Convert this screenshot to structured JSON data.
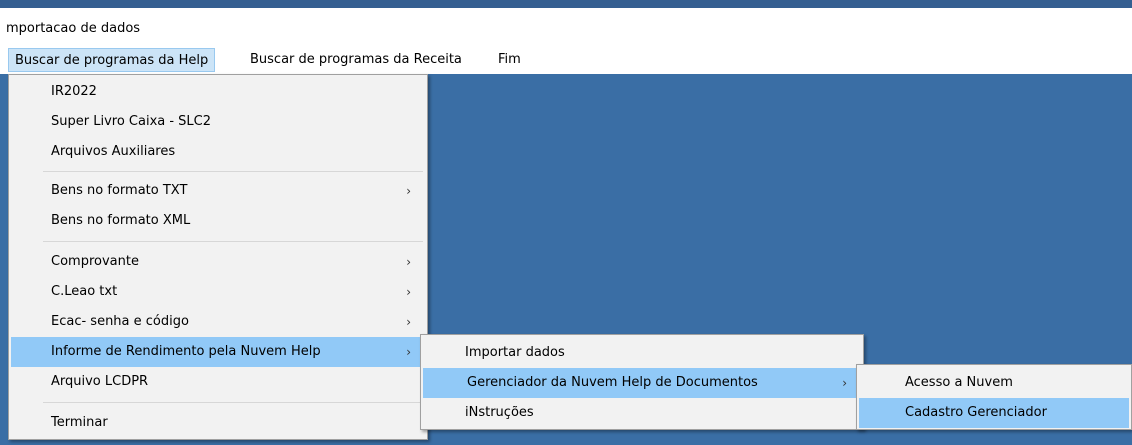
{
  "window": {
    "title": "mportacao de dados"
  },
  "menubar": {
    "items": [
      {
        "label": "Buscar de programas da Help"
      },
      {
        "label": "Buscar de programas da Receita"
      },
      {
        "label": "Fim"
      }
    ]
  },
  "main_menu": {
    "items": [
      {
        "label": "IR2022"
      },
      {
        "label": "Super Livro Caixa - SLC2"
      },
      {
        "label": "Arquivos Auxiliares"
      },
      {
        "label": "Bens no formato TXT",
        "arrow": "›"
      },
      {
        "label": "Bens no formato XML"
      },
      {
        "label": "Comprovante",
        "arrow": "›"
      },
      {
        "label": "C.Leao txt",
        "arrow": "›"
      },
      {
        "label": "Ecac- senha e código",
        "arrow": "›"
      },
      {
        "label": "Informe de Rendimento pela Nuvem Help",
        "arrow": "›"
      },
      {
        "label": "Arquivo LCDPR"
      },
      {
        "label": "Terminar"
      }
    ]
  },
  "submenu_1": {
    "items": [
      {
        "label": "Importar dados"
      },
      {
        "label": "Gerenciador da Nuvem Help de Documentos",
        "arrow": "›"
      },
      {
        "label": "iNstruções"
      }
    ]
  },
  "submenu_2": {
    "items": [
      {
        "label": "Acesso a Nuvem"
      },
      {
        "label": "Cadastro Gerenciador"
      }
    ]
  },
  "colors": {
    "desktop_bg": "#3a6ea5",
    "menu_bg": "#f2f2f2",
    "highlight": "#91c9f7",
    "menubar_active": "#cce4f7"
  }
}
